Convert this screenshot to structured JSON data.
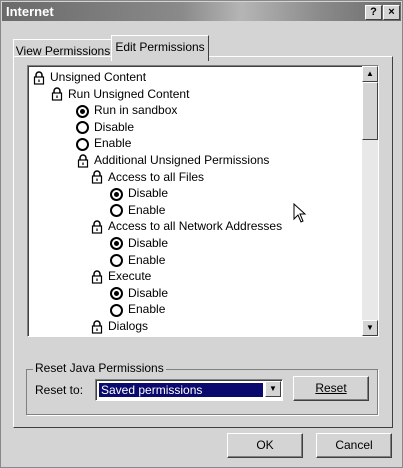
{
  "window": {
    "title": "Internet",
    "help_label": "?",
    "close_label": "×"
  },
  "tabs": [
    {
      "label": "View Permissions",
      "active": false
    },
    {
      "label": "Edit Permissions",
      "active": true
    }
  ],
  "tree": [
    {
      "type": "node",
      "label": "Unsigned Content",
      "level": 0
    },
    {
      "type": "node",
      "label": "Run Unsigned Content",
      "level": 1
    },
    {
      "type": "radio",
      "label": "Run in sandbox",
      "selected": true,
      "level": 2
    },
    {
      "type": "radio",
      "label": "Disable",
      "selected": false,
      "level": 2
    },
    {
      "type": "radio",
      "label": "Enable",
      "selected": false,
      "level": 2
    },
    {
      "type": "node",
      "label": "Additional Unsigned Permissions",
      "level": 2
    },
    {
      "type": "node",
      "label": "Access to all Files",
      "level": 3
    },
    {
      "type": "radio",
      "label": "Disable",
      "selected": true,
      "level": 4
    },
    {
      "type": "radio",
      "label": "Enable",
      "selected": false,
      "level": 4
    },
    {
      "type": "node",
      "label": "Access to all Network Addresses",
      "level": 3
    },
    {
      "type": "radio",
      "label": "Disable",
      "selected": true,
      "level": 4
    },
    {
      "type": "radio",
      "label": "Enable",
      "selected": false,
      "level": 4
    },
    {
      "type": "node",
      "label": "Execute",
      "level": 3
    },
    {
      "type": "radio",
      "label": "Disable",
      "selected": true,
      "level": 4
    },
    {
      "type": "radio",
      "label": "Enable",
      "selected": false,
      "level": 4
    },
    {
      "type": "node",
      "label": "Dialogs",
      "level": 3
    }
  ],
  "reset_group": {
    "title": "Reset Java Permissions",
    "reset_to_label": "Reset to:",
    "selected_value": "Saved permissions",
    "reset_button": "Reset"
  },
  "footer": {
    "ok_label": "OK",
    "cancel_label": "Cancel"
  },
  "icons": {
    "tree_node": "lock-icon",
    "cursor": "mouse-pointer-icon"
  }
}
